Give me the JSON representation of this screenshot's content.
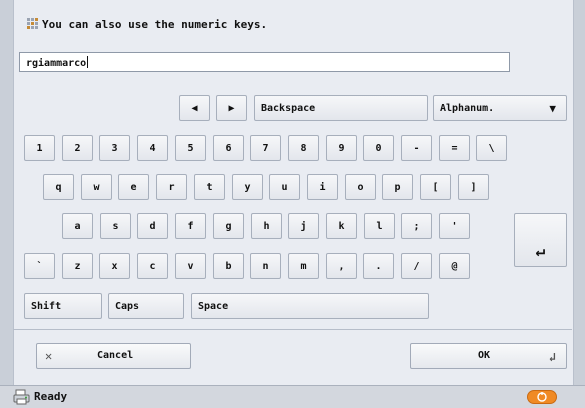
{
  "hint": {
    "text": "You can also use the numeric keys."
  },
  "input": {
    "value": "rgiammarco"
  },
  "controls": {
    "left_arrow": "◀",
    "right_arrow": "▶",
    "backspace": "Backspace",
    "mode_value": "Alphanum.",
    "mode_caret": "▼"
  },
  "keys": {
    "row1": [
      "1",
      "2",
      "3",
      "4",
      "5",
      "6",
      "7",
      "8",
      "9",
      "0",
      "-",
      "=",
      "\\"
    ],
    "row2": [
      "q",
      "w",
      "e",
      "r",
      "t",
      "y",
      "u",
      "i",
      "o",
      "p",
      "[",
      "]"
    ],
    "row3": [
      "a",
      "s",
      "d",
      "f",
      "g",
      "h",
      "j",
      "k",
      "l",
      ";",
      "'"
    ],
    "row4": [
      "`",
      "z",
      "x",
      "c",
      "v",
      "b",
      "n",
      "m",
      ",",
      ".",
      "/",
      "@"
    ],
    "enter": "↵"
  },
  "bottom_row": {
    "shift": "Shift",
    "caps": "Caps",
    "space": "Space"
  },
  "actions": {
    "cancel_icon": "✕",
    "cancel": "Cancel",
    "ok": "OK",
    "ok_icon": "↲"
  },
  "status": {
    "text": "Ready"
  },
  "colors": {
    "panel": "#e9ecf2",
    "accent_orange": "#f08a24"
  }
}
